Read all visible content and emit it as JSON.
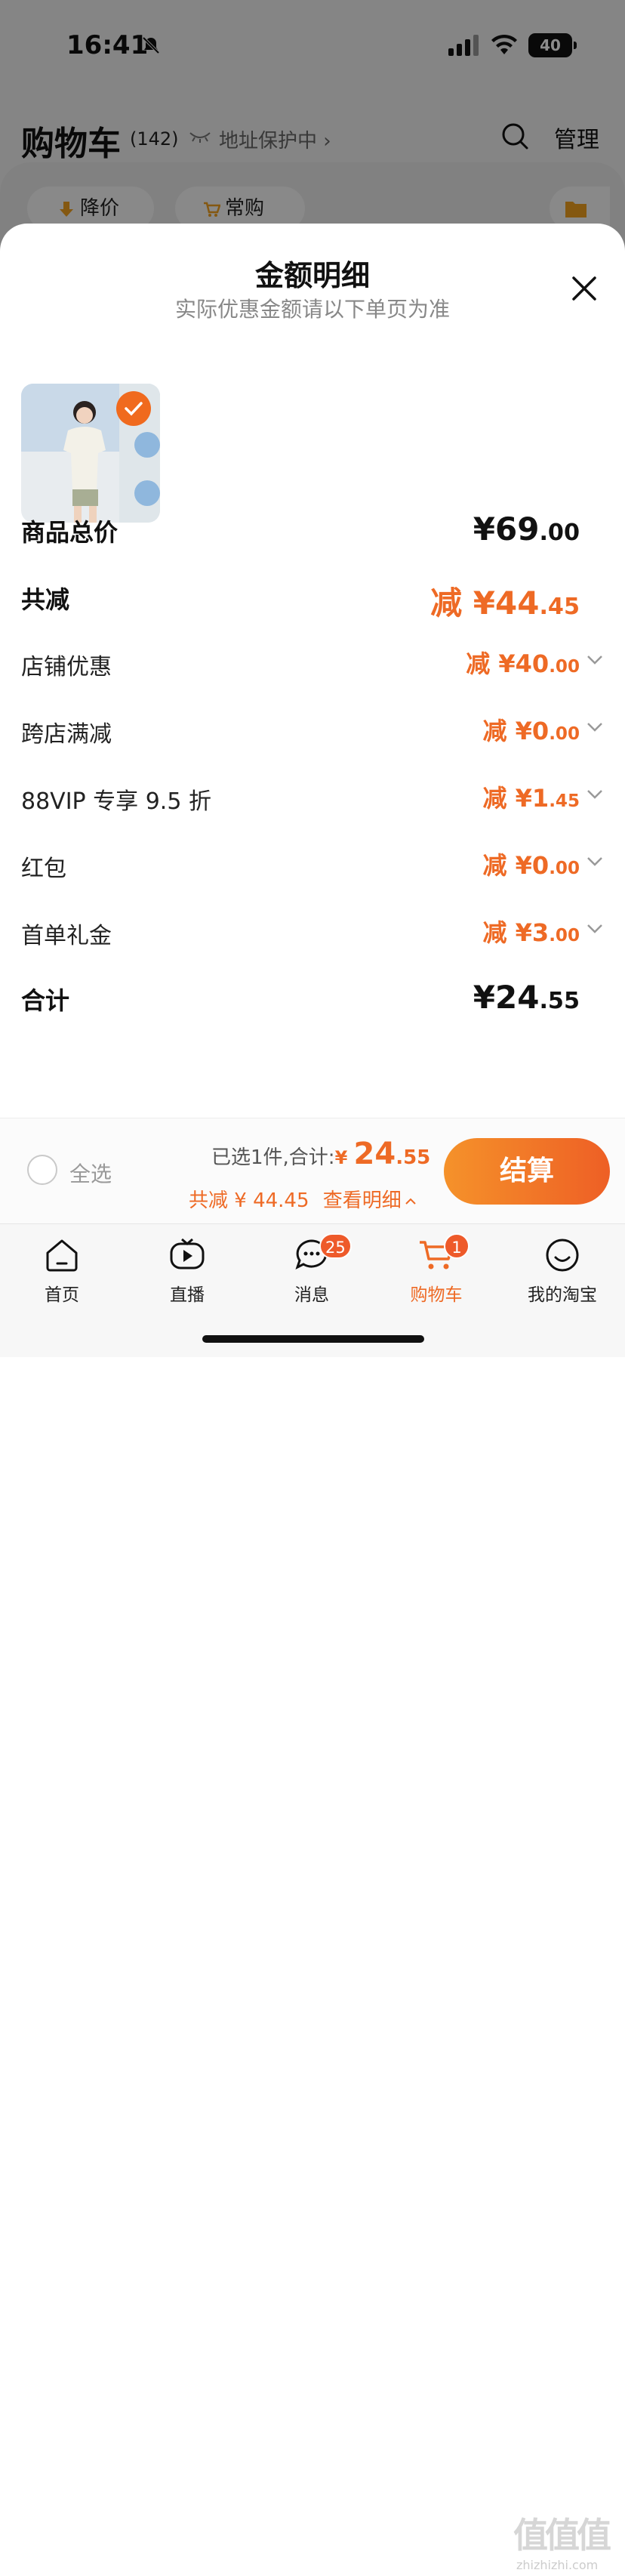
{
  "status_bar": {
    "time": "16:41",
    "battery": "40"
  },
  "cart_header": {
    "title": "购物车",
    "count": "(142)",
    "address": "地址保护中 ›",
    "manage": "管理"
  },
  "filter_chips": [
    {
      "label": "降价"
    },
    {
      "label": "常购"
    }
  ],
  "sheet": {
    "title": "金额明细",
    "subtitle": "实际优惠金额请以下单页为准",
    "rows": [
      {
        "label": "商品总价",
        "prefix": "",
        "main": "¥69",
        "dec": ".00"
      },
      {
        "label": "共减",
        "prefix": "减 ",
        "main": "¥44",
        "dec": ".45"
      },
      {
        "label": "店铺优惠",
        "prefix": "减 ",
        "main": "¥40",
        "dec": ".00"
      },
      {
        "label": "跨店满减",
        "prefix": "减 ",
        "main": "¥0",
        "dec": ".00"
      },
      {
        "label": "88VIP 专享 9.5 折",
        "prefix": "减 ",
        "main": "¥1",
        "dec": ".45"
      },
      {
        "label": "红包",
        "prefix": "减 ",
        "main": "¥0",
        "dec": ".00"
      },
      {
        "label": "首单礼金",
        "prefix": "减 ",
        "main": "¥3",
        "dec": ".00"
      },
      {
        "label": "合计",
        "prefix": "",
        "main": "¥24",
        "dec": ".55"
      }
    ]
  },
  "checkout": {
    "select_all": "全选",
    "selected_text": "已选1件,合计:",
    "currency": "¥",
    "total_main": "24",
    "total_dec": ".55",
    "discount_text": "共减 ¥ 44.45",
    "detail_link": "查看明细",
    "settle": "结算"
  },
  "tabs": [
    {
      "label": "首页",
      "icon": "home-icon"
    },
    {
      "label": "直播",
      "icon": "live-icon"
    },
    {
      "label": "消息",
      "icon": "message-icon",
      "badge": "25"
    },
    {
      "label": "购物车",
      "icon": "cart-icon",
      "badge": "1",
      "active": true
    },
    {
      "label": "我的淘宝",
      "icon": "profile-icon"
    }
  ],
  "watermark": {
    "text": "值值值",
    "url": "zhizhizhi.com"
  },
  "colors": {
    "accent": "#ee6a25",
    "accent_gradient_start": "#f5922a",
    "accent_gradient_end": "#ee5f25"
  }
}
